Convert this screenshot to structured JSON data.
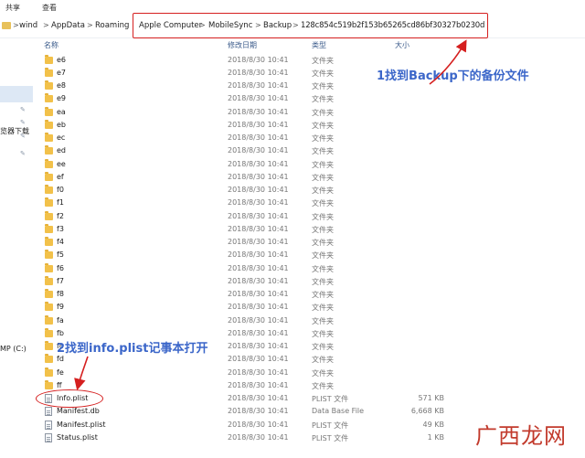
{
  "ribbon": {
    "tabs": [
      "共享",
      "查看"
    ]
  },
  "breadcrumb": {
    "items": [
      "wind",
      "AppData",
      "Roaming",
      "Apple Computer",
      "MobileSync",
      "Backup",
      "128c854c519b2f153b65265cd86bf30327b0230d"
    ],
    "separator": ">"
  },
  "nav": {
    "labels": [
      "览器下载",
      "MP (C:)"
    ]
  },
  "columns": {
    "name": "名称",
    "date": "修改日期",
    "type": "类型",
    "size": "大小"
  },
  "files": [
    {
      "name": "e6",
      "date": "2018/8/30 10:41",
      "type": "文件夹",
      "size": "",
      "kind": "folder"
    },
    {
      "name": "e7",
      "date": "2018/8/30 10:41",
      "type": "文件夹",
      "size": "",
      "kind": "folder"
    },
    {
      "name": "e8",
      "date": "2018/8/30 10:41",
      "type": "文件夹",
      "size": "",
      "kind": "folder"
    },
    {
      "name": "e9",
      "date": "2018/8/30 10:41",
      "type": "文件夹",
      "size": "",
      "kind": "folder"
    },
    {
      "name": "ea",
      "date": "2018/8/30 10:41",
      "type": "文件夹",
      "size": "",
      "kind": "folder"
    },
    {
      "name": "eb",
      "date": "2018/8/30 10:41",
      "type": "文件夹",
      "size": "",
      "kind": "folder"
    },
    {
      "name": "ec",
      "date": "2018/8/30 10:41",
      "type": "文件夹",
      "size": "",
      "kind": "folder"
    },
    {
      "name": "ed",
      "date": "2018/8/30 10:41",
      "type": "文件夹",
      "size": "",
      "kind": "folder"
    },
    {
      "name": "ee",
      "date": "2018/8/30 10:41",
      "type": "文件夹",
      "size": "",
      "kind": "folder"
    },
    {
      "name": "ef",
      "date": "2018/8/30 10:41",
      "type": "文件夹",
      "size": "",
      "kind": "folder"
    },
    {
      "name": "f0",
      "date": "2018/8/30 10:41",
      "type": "文件夹",
      "size": "",
      "kind": "folder"
    },
    {
      "name": "f1",
      "date": "2018/8/30 10:41",
      "type": "文件夹",
      "size": "",
      "kind": "folder"
    },
    {
      "name": "f2",
      "date": "2018/8/30 10:41",
      "type": "文件夹",
      "size": "",
      "kind": "folder"
    },
    {
      "name": "f3",
      "date": "2018/8/30 10:41",
      "type": "文件夹",
      "size": "",
      "kind": "folder"
    },
    {
      "name": "f4",
      "date": "2018/8/30 10:41",
      "type": "文件夹",
      "size": "",
      "kind": "folder"
    },
    {
      "name": "f5",
      "date": "2018/8/30 10:41",
      "type": "文件夹",
      "size": "",
      "kind": "folder"
    },
    {
      "name": "f6",
      "date": "2018/8/30 10:41",
      "type": "文件夹",
      "size": "",
      "kind": "folder"
    },
    {
      "name": "f7",
      "date": "2018/8/30 10:41",
      "type": "文件夹",
      "size": "",
      "kind": "folder"
    },
    {
      "name": "f8",
      "date": "2018/8/30 10:41",
      "type": "文件夹",
      "size": "",
      "kind": "folder"
    },
    {
      "name": "f9",
      "date": "2018/8/30 10:41",
      "type": "文件夹",
      "size": "",
      "kind": "folder"
    },
    {
      "name": "fa",
      "date": "2018/8/30 10:41",
      "type": "文件夹",
      "size": "",
      "kind": "folder"
    },
    {
      "name": "fb",
      "date": "2018/8/30 10:41",
      "type": "文件夹",
      "size": "",
      "kind": "folder"
    },
    {
      "name": "fc",
      "date": "2018/8/30 10:41",
      "type": "文件夹",
      "size": "",
      "kind": "folder"
    },
    {
      "name": "fd",
      "date": "2018/8/30 10:41",
      "type": "文件夹",
      "size": "",
      "kind": "folder"
    },
    {
      "name": "fe",
      "date": "2018/8/30 10:41",
      "type": "文件夹",
      "size": "",
      "kind": "folder"
    },
    {
      "name": "ff",
      "date": "2018/8/30 10:41",
      "type": "文件夹",
      "size": "",
      "kind": "folder"
    },
    {
      "name": "Info.plist",
      "date": "2018/8/30 10:41",
      "type": "PLIST 文件",
      "size": "571 KB",
      "kind": "file"
    },
    {
      "name": "Manifest.db",
      "date": "2018/8/30 10:41",
      "type": "Data Base File",
      "size": "6,668 KB",
      "kind": "file"
    },
    {
      "name": "Manifest.plist",
      "date": "2018/8/30 10:41",
      "type": "PLIST 文件",
      "size": "49 KB",
      "kind": "file"
    },
    {
      "name": "Status.plist",
      "date": "2018/8/30 10:41",
      "type": "PLIST 文件",
      "size": "1 KB",
      "kind": "file"
    }
  ],
  "annotations": {
    "step1": "1找到Backup下的备份文件",
    "step2": "2找到info.plist记事本打开",
    "color": "#3b66c9",
    "highlight_color": "#d51f1f"
  },
  "watermark": {
    "text": "广西龙网"
  }
}
